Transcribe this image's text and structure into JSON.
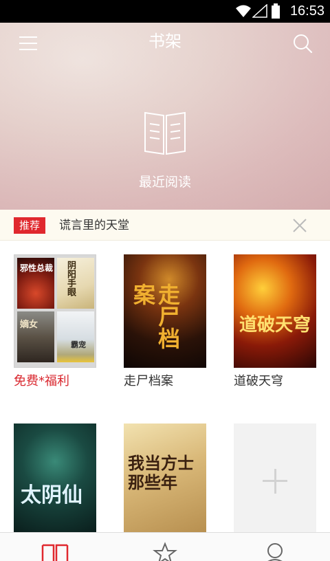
{
  "status_bar": {
    "time": "16:53",
    "icons": [
      "wifi-icon",
      "signal-icon",
      "battery-icon"
    ]
  },
  "header": {
    "title": "书架",
    "recent_label": "最近阅读"
  },
  "recommend": {
    "tag": "推荐",
    "title": "谎言里的天堂"
  },
  "books": [
    {
      "title": "免费*福利",
      "highlight": true,
      "cover": "collection",
      "mini_cover_texts": [
        "邪性总裁",
        "阴阳手眼",
        "嫡女",
        "霸宠"
      ]
    },
    {
      "title": "走尸档案",
      "cover": "走尸档案"
    },
    {
      "title": "道破天穹",
      "cover": "道破天穹"
    },
    {
      "title": "",
      "cover": "太阴仙"
    },
    {
      "title": "",
      "cover": "我当方士那些年"
    }
  ],
  "add_slot": {
    "icon": "plus-icon"
  },
  "bottom_nav": {
    "items": [
      "bookshelf-icon",
      "star-icon",
      "user-icon"
    ]
  },
  "colors": {
    "accent": "#e0282e",
    "recommend_bg": "#fdfaf0"
  }
}
